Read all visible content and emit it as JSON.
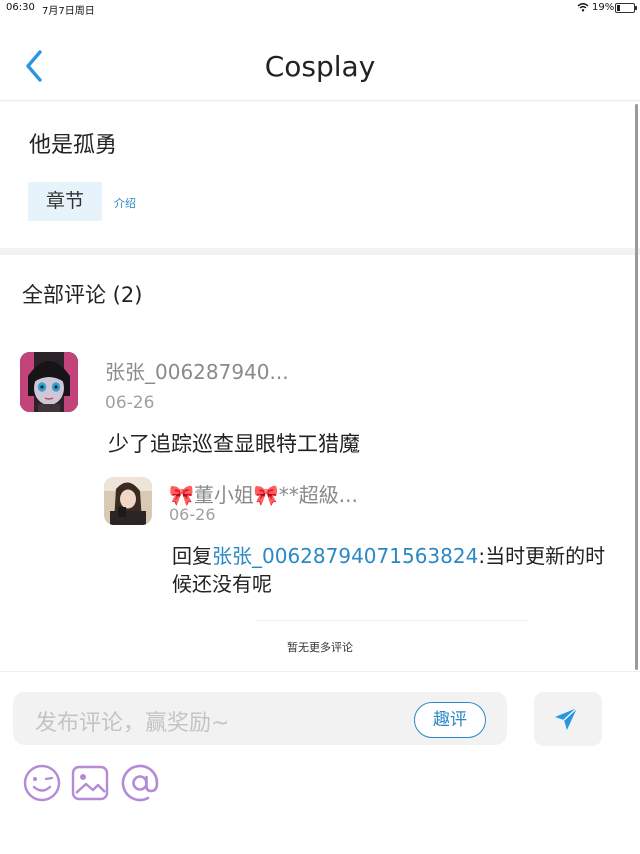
{
  "status": {
    "time": "06:30",
    "date": "7月7日周日",
    "battery_text": "19%",
    "battery_level": 0.19
  },
  "nav": {
    "title": "Cosplay",
    "back_icon": "chevron-left-icon"
  },
  "book": {
    "title": "他是孤勇",
    "chapter_tag": "章节",
    "intro_link": "介绍"
  },
  "comments": {
    "heading": "全部评论 (2)",
    "items": [
      {
        "user": "张张_006287940...",
        "date": "06-26",
        "text": "少了追踪巡查显眼特工猎魔"
      }
    ],
    "reply": {
      "user": "🎀董小姐🎀**超級...",
      "date": "06-26",
      "prefix": "回复",
      "mention": "张张_00628794071563824",
      "text": ":当时更新的时候还没有呢"
    },
    "no_more": "暂无更多评论"
  },
  "composer": {
    "placeholder": "发布评论，赢奖励~",
    "qp_label": "趣评",
    "send_icon": "send-icon",
    "tools": [
      "emoji-icon",
      "image-icon",
      "at-icon"
    ]
  },
  "colors": {
    "accent": "#2a89c5",
    "send": "#2a95e0",
    "tool_icons": "#b58ad6"
  }
}
